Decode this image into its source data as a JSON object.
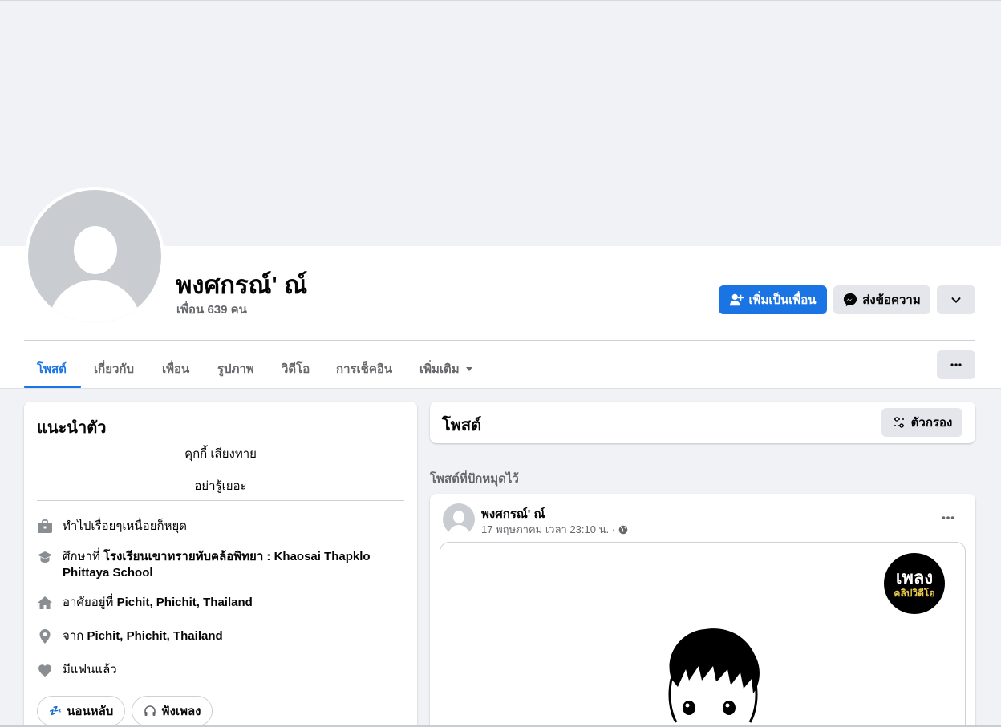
{
  "profile": {
    "name": "พงศกรณ์' ณ์",
    "friends_count": "เพื่อน 639 คน",
    "add_friend_label": "เพิ่มเป็นเพื่อน",
    "message_label": "ส่งข้อความ"
  },
  "tabs": [
    {
      "label": "โพสต์",
      "active": true
    },
    {
      "label": "เกี่ยวกับ"
    },
    {
      "label": "เพื่อน"
    },
    {
      "label": "รูปภาพ"
    },
    {
      "label": "วิดีโอ"
    },
    {
      "label": "การเช็คอิน"
    },
    {
      "label": "เพิ่มเติม"
    }
  ],
  "intro": {
    "title": "แนะนำตัว",
    "bio_lines": [
      "คุกกี้ เสียงทาย",
      "อย่ารู้เยอะ"
    ],
    "work": "ทำไปเรื่อยๆเหนื่อยก็หยุด",
    "education_prefix": "ศึกษาที่",
    "education_school": "โรงเรียนเขาทรายทับคล้อพิทยา : Khaosai Thapklo Phittaya School",
    "lives_prefix": "อาศัยอยู่ที่",
    "lives_place": "Pichit, Phichit, Thailand",
    "from_prefix": "จาก",
    "from_place": "Pichit, Phichit, Thailand",
    "relationship": "มีแฟนแล้ว",
    "hobbies": [
      "นอนหลับ",
      "ฟังเพลง"
    ]
  },
  "posts": {
    "title": "โพสต์",
    "filter_label": "ตัวกรอง",
    "pinned_label": "โพสต์ที่ปักหมุดไว้"
  },
  "post": {
    "author": "พงศกรณ์' ณ์",
    "timestamp": "17 พฤษภาคม เวลา 23:10 น. ·",
    "logo_top": "เพลง",
    "logo_bottom": "คลิปวิดีโอ"
  },
  "colors": {
    "accent": "#1b74e4",
    "secondary_button": "#e4e6eb",
    "muted_text": "#65676b",
    "page_bg": "#f0f2f5"
  }
}
